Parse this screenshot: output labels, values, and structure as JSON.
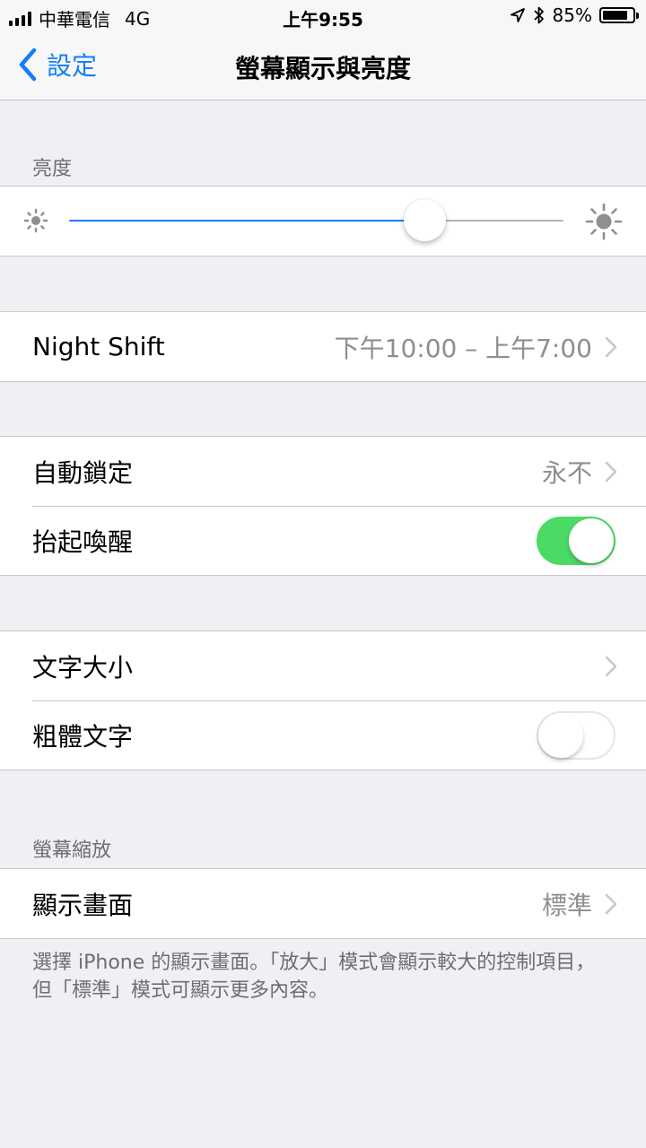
{
  "status_bar": {
    "carrier": "中華電信",
    "network": "4G",
    "time": "上午9:55",
    "battery_percent": "85%",
    "battery_level": 0.85,
    "icons": [
      "location-arrow-icon",
      "bluetooth-icon",
      "battery-icon",
      "signal-icon"
    ]
  },
  "nav": {
    "back_label": "設定",
    "title": "螢幕顯示與亮度"
  },
  "brightness": {
    "header": "亮度",
    "level": 0.72,
    "accent_color": "#147efb"
  },
  "night_shift": {
    "label": "Night Shift",
    "value": "下午10:00 – 上午7:00"
  },
  "lock_group": {
    "auto_lock_label": "自動鎖定",
    "auto_lock_value": "永不",
    "raise_to_wake_label": "抬起喚醒",
    "raise_to_wake_on": true
  },
  "text_group": {
    "text_size_label": "文字大小",
    "bold_text_label": "粗體文字",
    "bold_text_on": false
  },
  "zoom": {
    "header": "螢幕縮放",
    "view_label": "顯示畫面",
    "view_value": "標準",
    "footer": "選擇 iPhone 的顯示畫面。「放大」模式會顯示較大的控制項目，但「標準」模式可顯示更多內容。"
  },
  "colors": {
    "toggle_on": "#4cd964",
    "background": "#efeff4"
  }
}
